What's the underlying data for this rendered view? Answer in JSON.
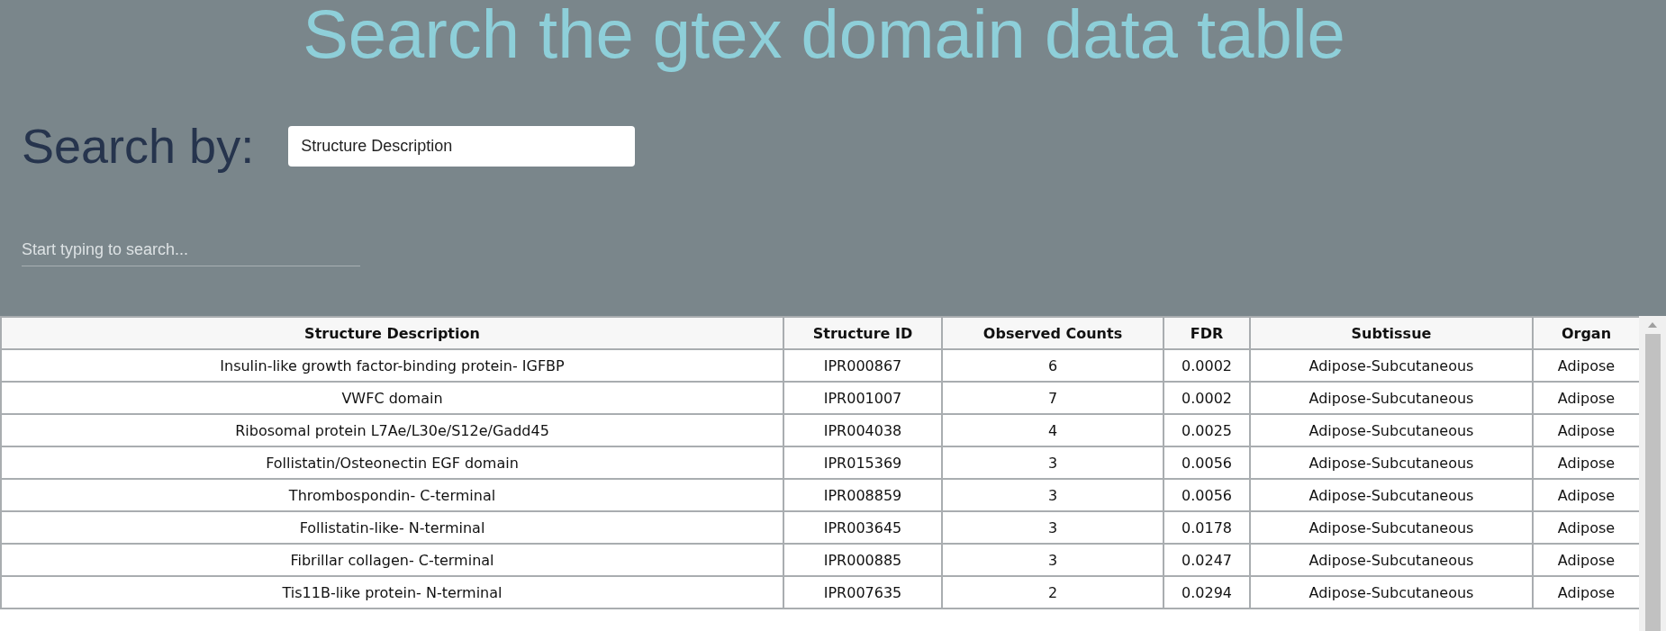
{
  "title": "Search the gtex domain data table",
  "search_by": {
    "label": "Search by:",
    "value": "Structure Description"
  },
  "search": {
    "placeholder": "Start typing to search..."
  },
  "table": {
    "columns": [
      "Structure Description",
      "Structure ID",
      "Observed Counts",
      "FDR",
      "Subtissue",
      "Organ"
    ],
    "rows": [
      [
        "Insulin-like growth factor-binding protein- IGFBP",
        "IPR000867",
        "6",
        "0.0002",
        "Adipose-Subcutaneous",
        "Adipose"
      ],
      [
        "VWFC domain",
        "IPR001007",
        "7",
        "0.0002",
        "Adipose-Subcutaneous",
        "Adipose"
      ],
      [
        "Ribosomal protein L7Ae/L30e/S12e/Gadd45",
        "IPR004038",
        "4",
        "0.0025",
        "Adipose-Subcutaneous",
        "Adipose"
      ],
      [
        "Follistatin/Osteonectin EGF domain",
        "IPR015369",
        "3",
        "0.0056",
        "Adipose-Subcutaneous",
        "Adipose"
      ],
      [
        "Thrombospondin- C-terminal",
        "IPR008859",
        "3",
        "0.0056",
        "Adipose-Subcutaneous",
        "Adipose"
      ],
      [
        "Follistatin-like- N-terminal",
        "IPR003645",
        "3",
        "0.0178",
        "Adipose-Subcutaneous",
        "Adipose"
      ],
      [
        "Fibrillar collagen- C-terminal",
        "IPR000885",
        "3",
        "0.0247",
        "Adipose-Subcutaneous",
        "Adipose"
      ],
      [
        "Tis11B-like protein- N-terminal",
        "IPR007635",
        "2",
        "0.0294",
        "Adipose-Subcutaneous",
        "Adipose"
      ]
    ]
  }
}
